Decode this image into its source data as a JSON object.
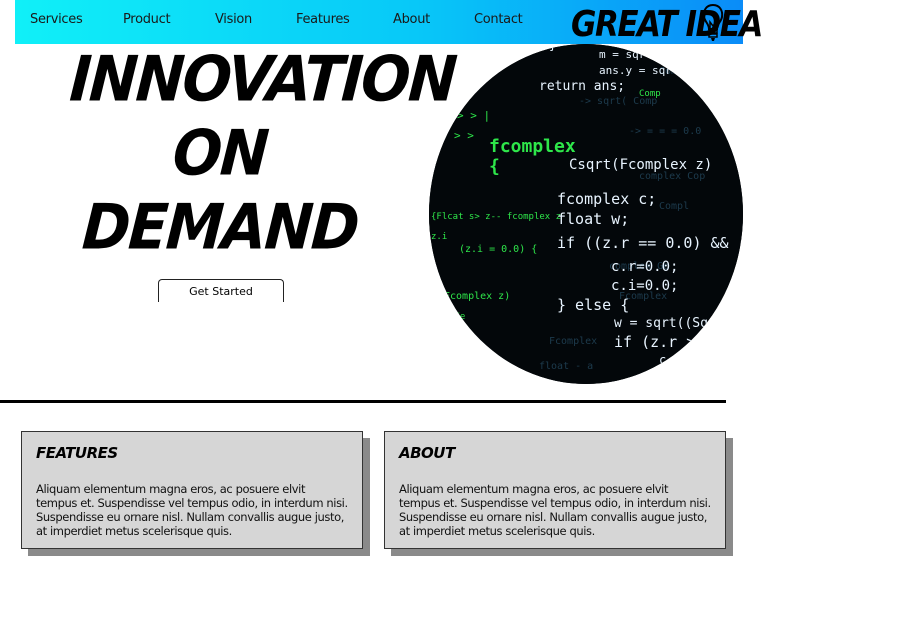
{
  "nav": {
    "items": [
      {
        "label": "Services"
      },
      {
        "label": "Product"
      },
      {
        "label": "Vision"
      },
      {
        "label": "Features"
      },
      {
        "label": "About"
      },
      {
        "label": "Contact"
      }
    ],
    "logo_text": "GREAT IDEA",
    "logo_icon": "lightbulb-icon"
  },
  "hero": {
    "headline_lines": [
      "INNOVATION",
      "ON",
      "DEMAND"
    ],
    "cta_label": "Get Started",
    "image_icon": "code-screen-image"
  },
  "cards": [
    {
      "title": "FEATURES",
      "body": "Aliquam elementum magna eros, ac posuere elvit tempus et. Suspendisse vel tempus odio, in interdum nisi. Suspendisse eu ornare nisl. Nullam convallis augue justo, at imperdiet metus scelerisque quis."
    },
    {
      "title": "ABOUT",
      "body": "Aliquam elementum magna eros, ac posuere elvit tempus et. Suspendisse vel tempus odio, in interdum nisi. Suspendisse eu ornare nisl. Nullam convallis augue justo, at imperdiet metus scelerisque quis."
    }
  ],
  "colors": {
    "nav_gradient_start": "#10f0f8",
    "nav_gradient_end": "#0a8cf8",
    "card_background": "#d6d6d6",
    "code_green": "#2ee64a",
    "code_white": "#e8f4ff"
  }
}
